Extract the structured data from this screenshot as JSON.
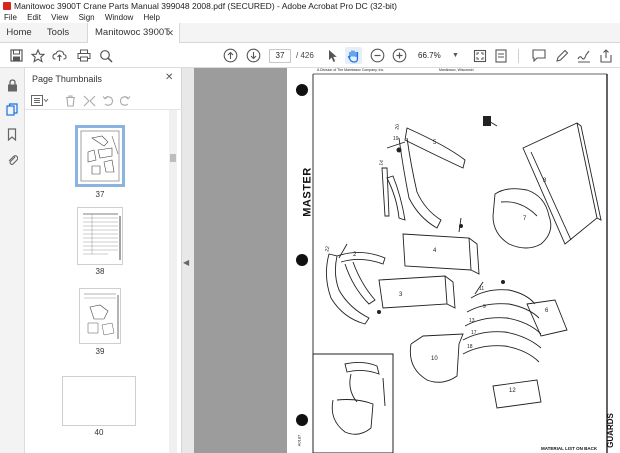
{
  "window": {
    "title": "Manitowoc 3900T Crane Parts Manual 399048 2008.pdf (SECURED) - Adobe Acrobat Pro DC (32-bit)"
  },
  "menu": [
    "File",
    "Edit",
    "View",
    "Sign",
    "Window",
    "Help"
  ],
  "tabs": {
    "home": "Home",
    "tools": "Tools",
    "document": "Manitowoc 3900T ..."
  },
  "toolbar": {
    "current_page": "37",
    "page_count": "/ 426",
    "zoom": "66.7%"
  },
  "panel": {
    "title": "Page Thumbnails",
    "thumbnails": [
      {
        "label": "37",
        "selected": true
      },
      {
        "label": "38",
        "selected": false
      },
      {
        "label": "39",
        "selected": false
      },
      {
        "label": "40",
        "selected": false
      }
    ]
  },
  "document": {
    "header_left": "A Division of The Manitowoc Company, Inc.",
    "header_right": "Manitowoc, Wisconsin",
    "side_label": "MASTER",
    "footer_note": "MATERIAL LIST ON BACK",
    "right_edge_label": "GUARDS",
    "figure_code": "A0187",
    "part_numbers": [
      "2",
      "3",
      "4",
      "5",
      "6",
      "7",
      "8",
      "9",
      "10",
      "11",
      "12",
      "13",
      "14",
      "17",
      "18",
      "19",
      "20",
      "22"
    ]
  },
  "colors": {
    "accent": "#1473e6",
    "selection": "#8ab4e0",
    "canvas": "#9c9c9c"
  }
}
